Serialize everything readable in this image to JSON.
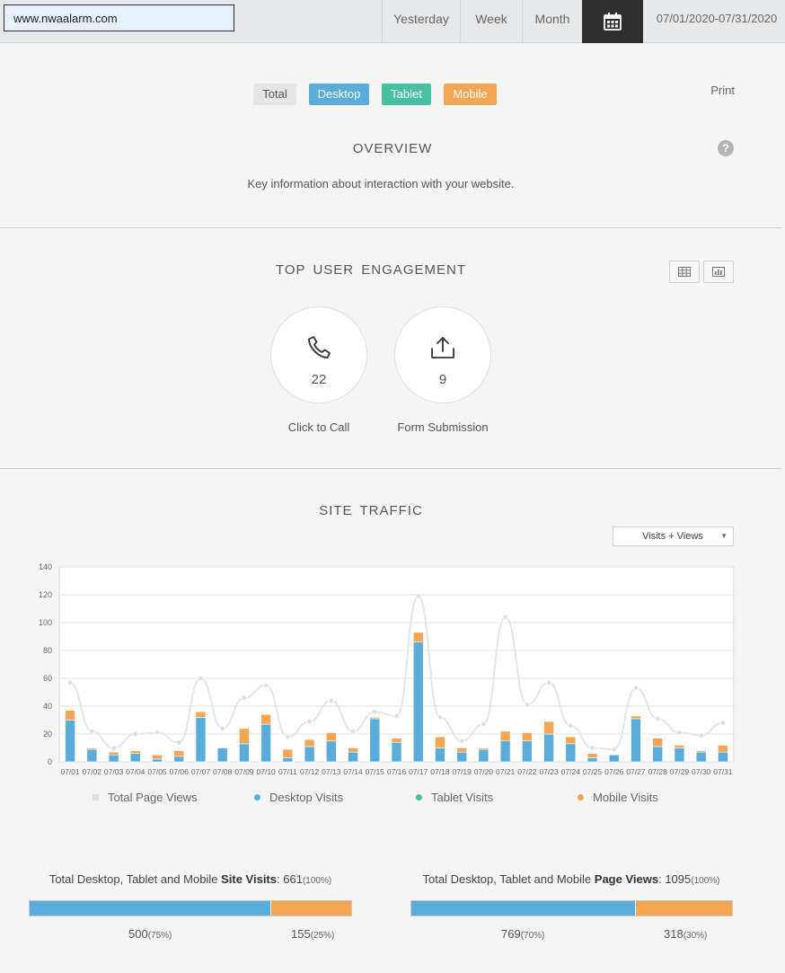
{
  "header": {
    "url_value": "www.nwaalarm.com",
    "range_buttons": {
      "yesterday": "Yesterday",
      "week": "Week",
      "month": "Month"
    },
    "date_range": "07/01/2020-07/31/2020"
  },
  "filters": {
    "total": "Total",
    "desktop": "Desktop",
    "tablet": "Tablet",
    "mobile": "Mobile",
    "print": "Print"
  },
  "overview": {
    "title": "OVERVIEW",
    "description": "Key information about interaction with your website.",
    "help": "?"
  },
  "engagement": {
    "title": "TOP USER ENGAGEMENT",
    "items": [
      {
        "label": "Click to Call",
        "value": "22",
        "icon": "phone-icon"
      },
      {
        "label": "Form Submission",
        "value": "9",
        "icon": "upload-icon"
      }
    ]
  },
  "traffic": {
    "title": "SITE TRAFFIC",
    "select_value": "Visits + Views"
  },
  "colors": {
    "desktop": "#5aaddb",
    "tablet": "#47c0a1",
    "mobile": "#f4a652",
    "page_views": "#dde0e6"
  },
  "chart_data": {
    "type": "bar",
    "categories": [
      "07/01",
      "07/02",
      "07/03",
      "07/04",
      "07/05",
      "07/06",
      "07/07",
      "07/08",
      "07/09",
      "07/10",
      "07/11",
      "07/12",
      "07/13",
      "07/14",
      "07/15",
      "07/16",
      "07/17",
      "07/18",
      "07/19",
      "07/20",
      "07/21",
      "07/22",
      "07/23",
      "07/24",
      "07/25",
      "07/26",
      "07/27",
      "07/28",
      "07/29",
      "07/30",
      "07/31"
    ],
    "ylim": [
      0,
      140
    ],
    "yticks": [
      0,
      20,
      40,
      60,
      80,
      100,
      120,
      140
    ],
    "grid": true,
    "legend_position": "bottom",
    "series": [
      {
        "name": "Desktop Visits",
        "kind": "stacked-bar",
        "values": [
          30,
          9,
          5,
          6,
          2,
          4,
          32,
          10,
          13,
          27,
          3,
          11,
          15,
          7,
          31,
          14,
          86,
          10,
          7,
          9,
          15,
          15,
          20,
          13,
          3,
          5,
          31,
          11,
          10,
          7,
          7
        ]
      },
      {
        "name": "Tablet Visits",
        "kind": "stacked-bar",
        "values": [
          0,
          0,
          0,
          0,
          0,
          0,
          0,
          0,
          0,
          0,
          0,
          0,
          0,
          0,
          0,
          0,
          0,
          0,
          0,
          0,
          0,
          0,
          0,
          0,
          0,
          0,
          0,
          0,
          0,
          0,
          0
        ]
      },
      {
        "name": "Mobile Visits",
        "kind": "stacked-bar",
        "values": [
          7,
          1,
          2,
          2,
          3,
          4,
          4,
          0,
          11,
          7,
          6,
          5,
          6,
          3,
          1,
          3,
          7,
          8,
          3,
          1,
          7,
          6,
          9,
          5,
          3,
          0,
          2,
          6,
          2,
          1,
          5
        ]
      },
      {
        "name": "Total Page Views",
        "kind": "line",
        "values": [
          57,
          22,
          10,
          20,
          21,
          14,
          60,
          24,
          46,
          55,
          18,
          29,
          44,
          22,
          36,
          33,
          119,
          32,
          15,
          27,
          104,
          41,
          57,
          26,
          10,
          9,
          53,
          31,
          21,
          19,
          28
        ]
      }
    ]
  },
  "summary": {
    "visits": {
      "title_prefix": "Total Desktop, Tablet and Mobile",
      "title_bold": "Site Visits",
      "total": "661",
      "total_pct": "(100%)",
      "desktop_value": "500",
      "desktop_pct": "(75%)",
      "mobile_value": "155",
      "mobile_pct": "(25%)",
      "desktop_share": 0.75
    },
    "views": {
      "title_prefix": "Total Desktop, Tablet and Mobile",
      "title_bold": "Page Views",
      "total": "1095",
      "total_pct": "(100%)",
      "desktop_value": "769",
      "desktop_pct": "(70%)",
      "mobile_value": "318",
      "mobile_pct": "(30%)",
      "desktop_share": 0.7
    }
  }
}
